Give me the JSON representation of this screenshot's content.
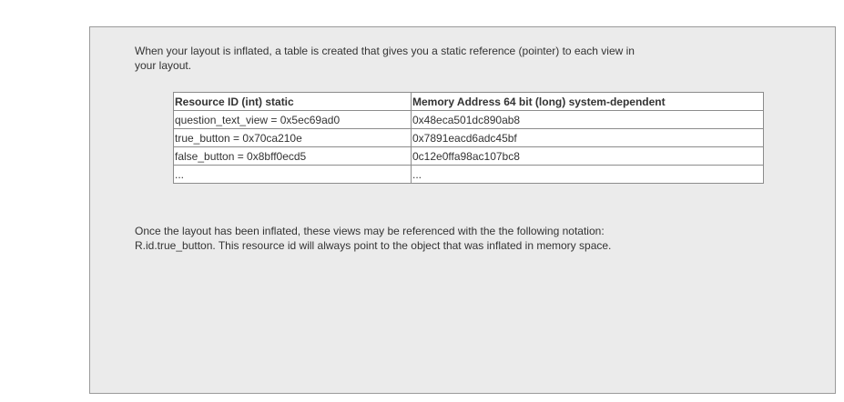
{
  "intro_text": "When your layout is inflated, a table is created that gives you a static reference (pointer) to each view in your layout.",
  "table": {
    "headers": [
      "Resource ID (int) static",
      "Memory Address 64 bit (long) system-dependent"
    ],
    "rows": [
      [
        "question_text_view = 0x5ec69ad0",
        "0x48eca501dc890ab8"
      ],
      [
        "true_button = 0x70ca210e",
        "0x7891eacd6adc45bf"
      ],
      [
        "false_button = 0x8bff0ecd5",
        "0c12e0ffa98ac107bc8"
      ],
      [
        "...",
        "..."
      ]
    ]
  },
  "outro_text": "Once the layout has been inflated, these views may be referenced with the the following notation: R.id.true_button. This resource id will always point to the object that was inflated in memory space."
}
